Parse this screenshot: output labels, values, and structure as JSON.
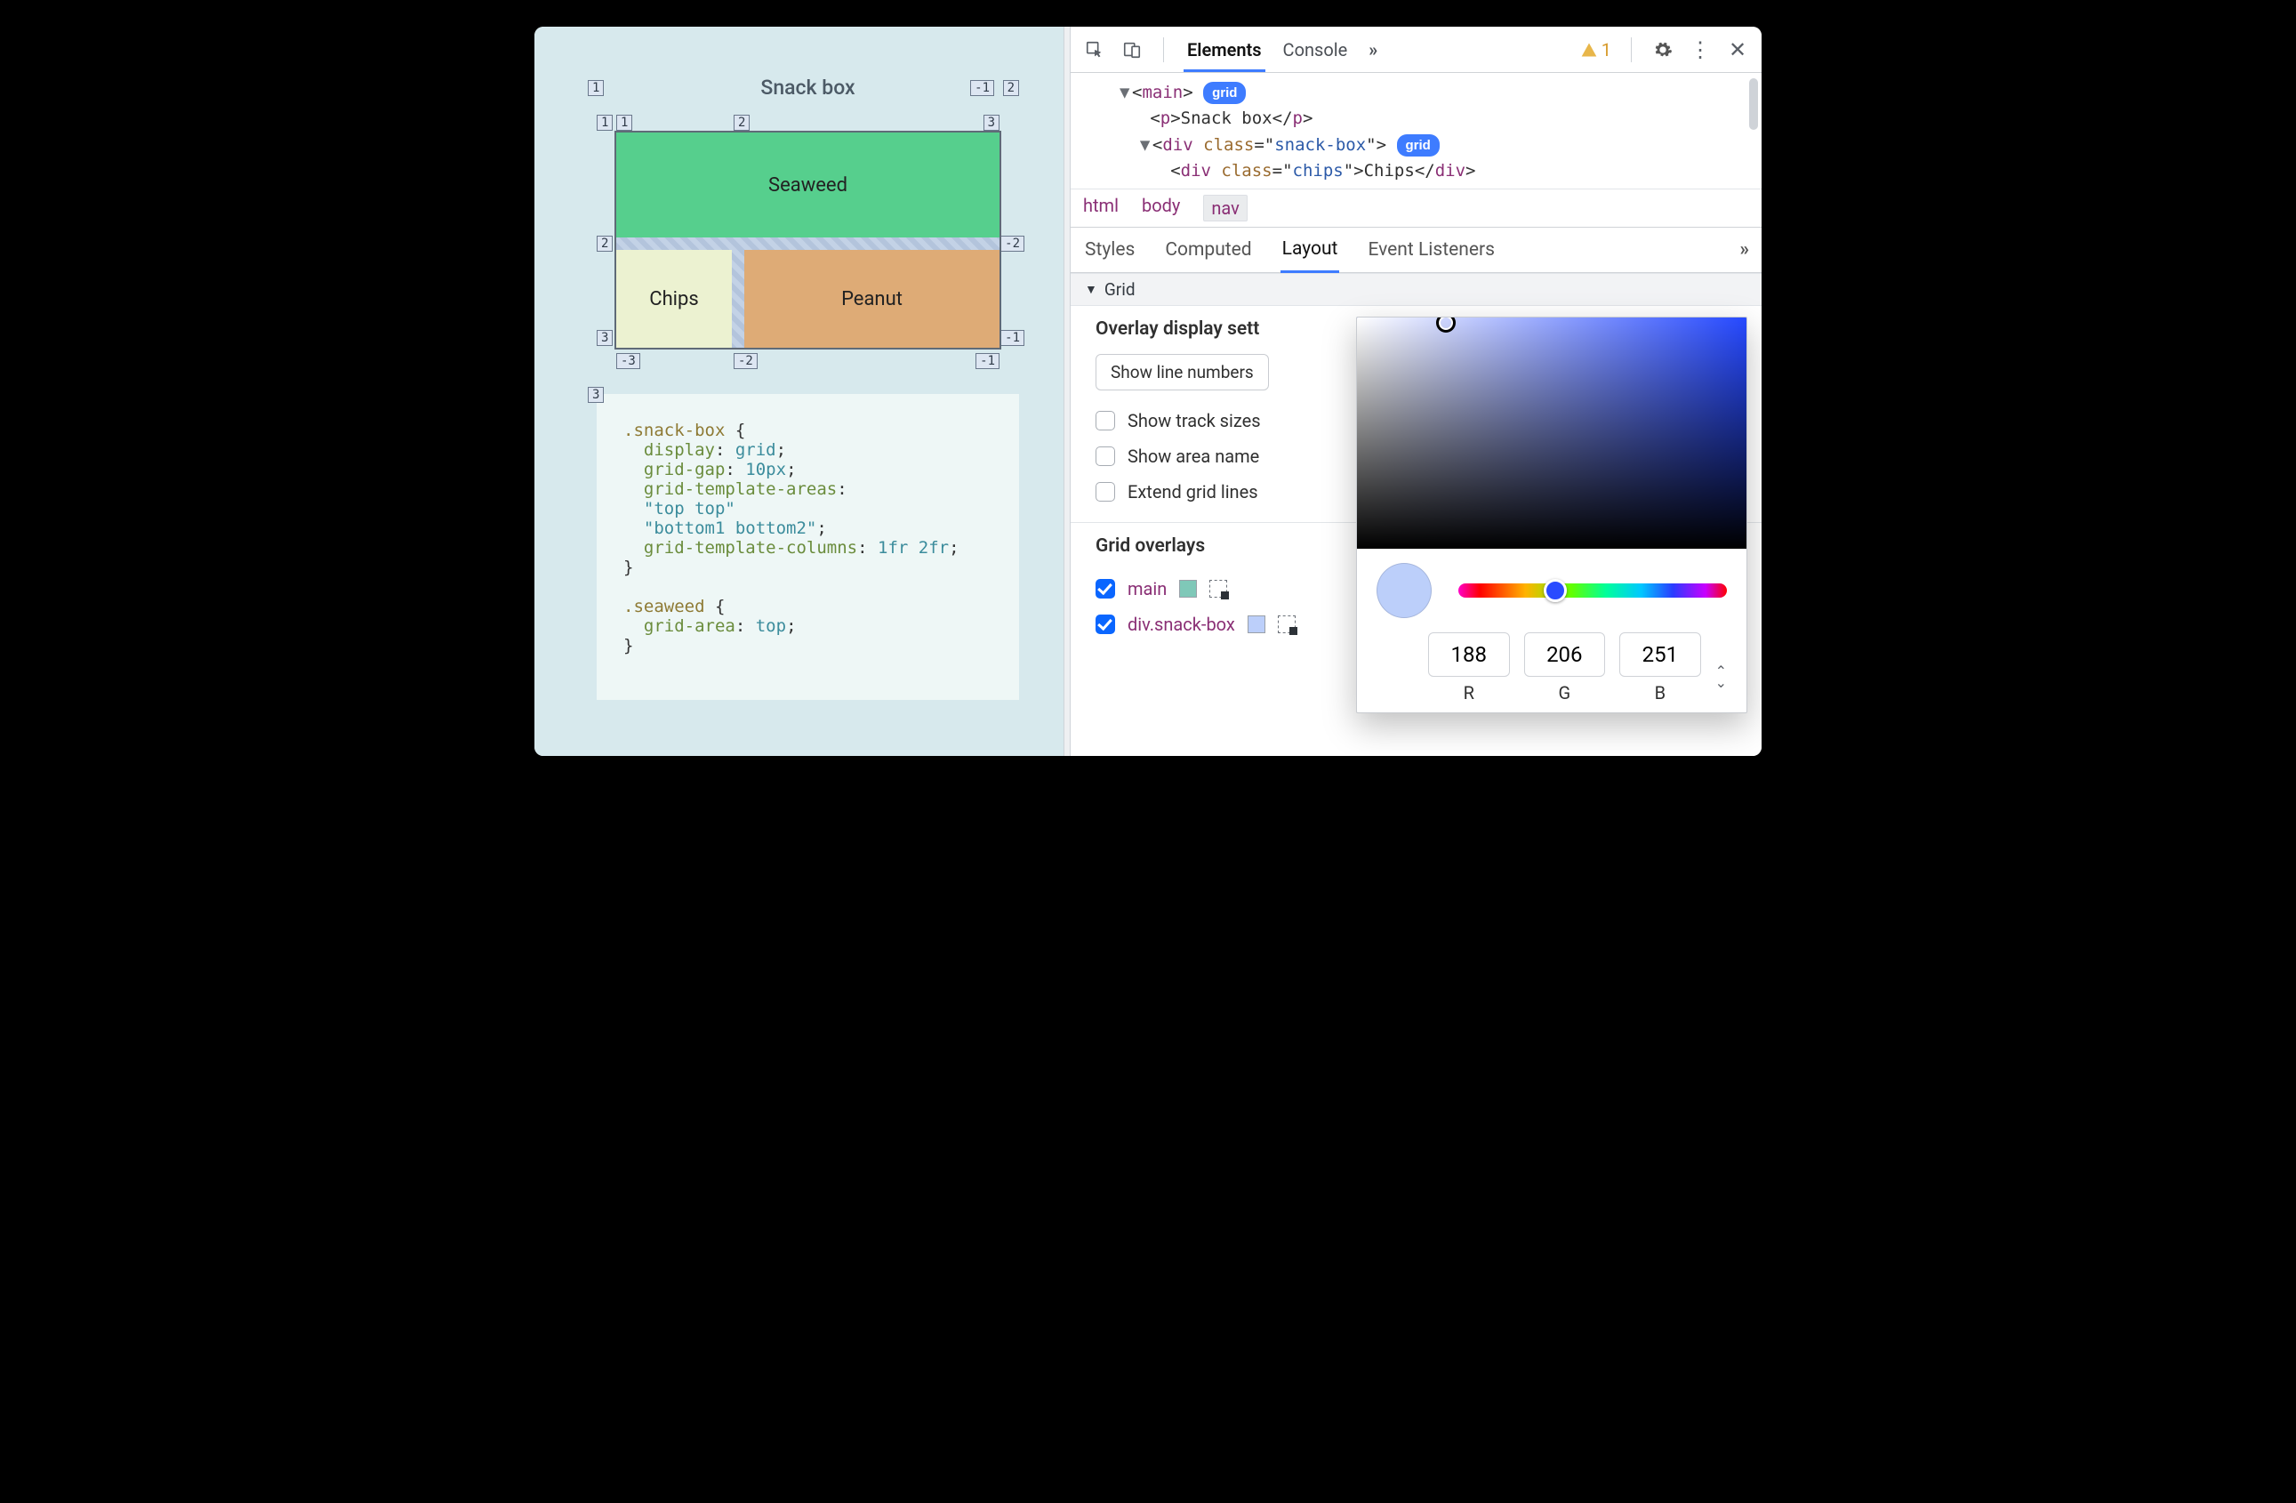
{
  "page": {
    "title": "Snack box",
    "cells": {
      "seaweed": "Seaweed",
      "chips": "Chips",
      "peanut": "Peanut"
    },
    "lineLabels": {
      "outer": {
        "tl": "1",
        "tr": "-1",
        "tr2": "2",
        "bl": "3"
      },
      "colTop": {
        "a": "1",
        "b": "2",
        "c": "3"
      },
      "row1": {
        "l": "2",
        "r": "-2"
      },
      "row2": {
        "l": "3",
        "r": "-1"
      },
      "row2b": {
        "bl": "-3",
        "bm": "-2",
        "br": "-1"
      }
    },
    "code": ".snack-box {\n  display: grid;\n  grid-gap: 10px;\n  grid-template-areas:\n  \"top top\"\n  \"bottom1 bottom2\";\n  grid-template-columns: 1fr 2fr;\n}\n\n.seaweed {\n  grid-area: top;\n}"
  },
  "devtools": {
    "mainTabs": {
      "elements": "Elements",
      "console": "Console"
    },
    "warningCount": "1",
    "dom": {
      "l1_tag": "main",
      "l1_badge": "grid",
      "l2_tag": "p",
      "l2_text": "Snack box",
      "l3_tag": "div",
      "l3_attr": "class",
      "l3_val": "snack-box",
      "l3_badge": "grid",
      "l4_tag": "div",
      "l4_attr": "class",
      "l4_val": "chips",
      "l4_text": "Chips"
    },
    "crumbs": [
      "html",
      "body",
      "nav"
    ],
    "subtabs": {
      "styles": "Styles",
      "computed": "Computed",
      "layout": "Layout",
      "ev": "Event Listeners"
    },
    "layout": {
      "gridHeader": "Grid",
      "overlayTitle": "Overlay display sett",
      "dropdown": "Show line numbers",
      "opts": {
        "trackSizes": "Show track sizes",
        "areaNames": "Show area name",
        "extend": "Extend grid lines"
      },
      "overlaysTitle": "Grid overlays",
      "overlays": [
        {
          "name": "main",
          "checked": true,
          "swatch": "#7fc8b8"
        },
        {
          "name": "div.snack-box",
          "checked": true,
          "swatch": "#bccffa"
        }
      ]
    },
    "picker": {
      "r": "188",
      "g": "206",
      "b": "251",
      "labels": {
        "r": "R",
        "g": "G",
        "b": "B"
      }
    }
  }
}
